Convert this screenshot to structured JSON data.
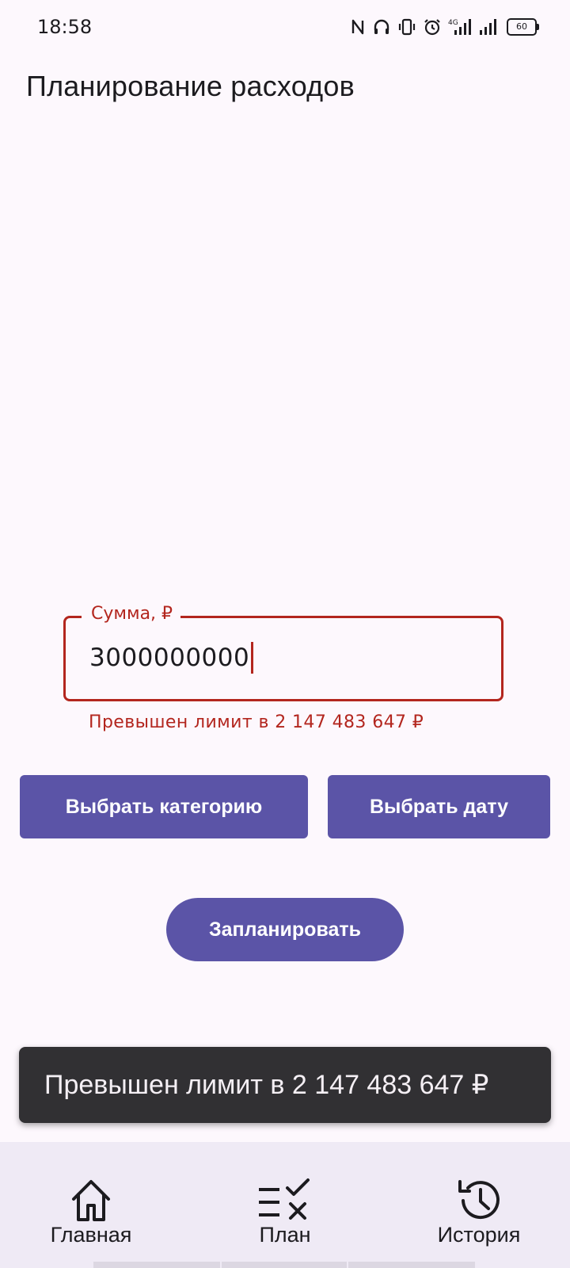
{
  "status_bar": {
    "time": "18:58",
    "battery": "60",
    "icons": [
      "nfc-icon",
      "headphones-icon",
      "vibrate-icon",
      "alarm-icon",
      "signal-4g-icon",
      "signal-icon",
      "battery-icon"
    ]
  },
  "page": {
    "title": "Планирование расходов"
  },
  "amount_field": {
    "label": "Сумма, ₽",
    "value": "3000000000",
    "error": "Превышен лимит в 2 147 483 647 ₽"
  },
  "buttons": {
    "category": "Выбрать категорию",
    "date": "Выбрать дату",
    "plan": "Запланировать"
  },
  "snackbar": {
    "message": "Превышен лимит в 2 147 483 647 ₽"
  },
  "bottom_nav": {
    "items": [
      {
        "label": "Главная",
        "icon": "home-icon"
      },
      {
        "label": "План",
        "icon": "plan-checklist-icon"
      },
      {
        "label": "История",
        "icon": "history-icon"
      }
    ]
  },
  "colors": {
    "primary": "#5b54a7",
    "error": "#b3261e",
    "background": "#fdf8fd",
    "snackbar": "#313033",
    "nav_background": "#efeaf5"
  }
}
